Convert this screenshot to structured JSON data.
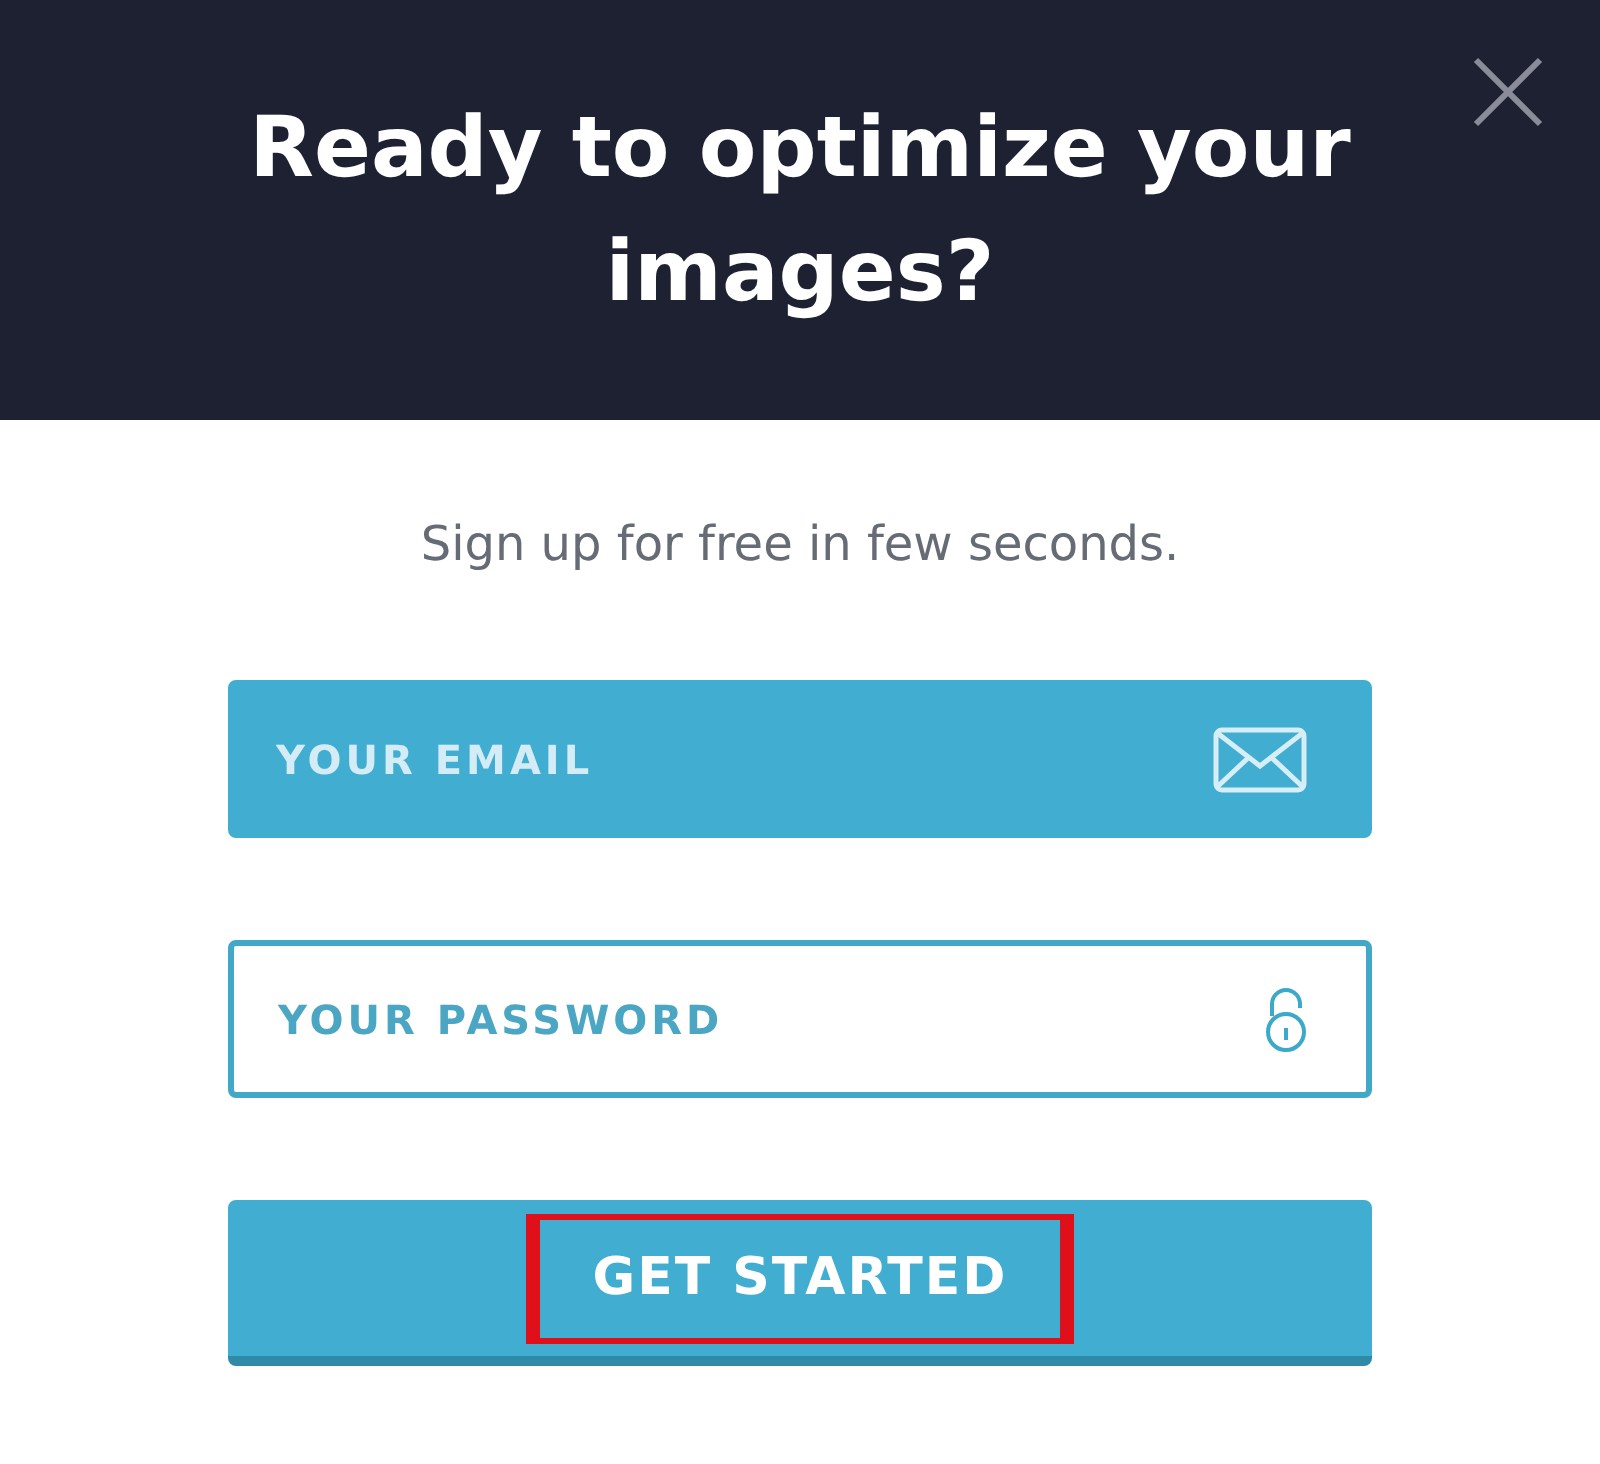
{
  "header": {
    "title": "Ready to optimize your images?"
  },
  "subtitle": "Sign up for free in few seconds.",
  "fields": [
    {
      "kind": "email",
      "placeholder": "YOUR EMAIL",
      "focused": true
    },
    {
      "kind": "password",
      "placeholder": "YOUR PASSWORD",
      "focused": false
    }
  ],
  "submit": {
    "label": "GET STARTED",
    "highlighted": true
  }
}
